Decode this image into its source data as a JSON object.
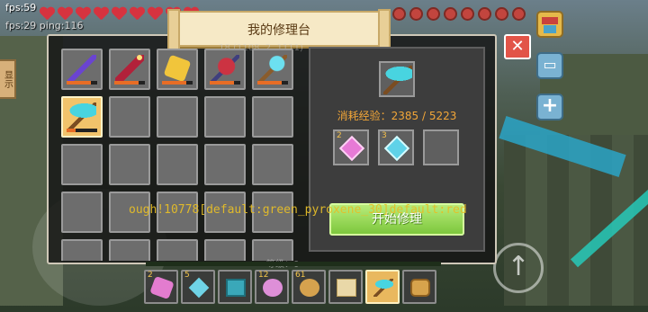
{
  "hud": {
    "fps": "fps:59",
    "ping": "fps:29 ping:116",
    "hearts": 9,
    "food": 8,
    "side_tab": "显示"
  },
  "dialog": {
    "title": "我的修理台",
    "faint_text": "… 18 (1108, 2, 1111)",
    "close_label": "✕",
    "inventory": [
      {
        "icon": "purple-sword-icon",
        "durability": 0.8
      },
      {
        "icon": "red-sword-icon",
        "durability": 0.8
      },
      {
        "icon": "golden-scroll-icon",
        "durability": 0.8
      },
      {
        "icon": "red-axe-icon",
        "durability": 0.8
      },
      {
        "icon": "diamond-shovel-icon",
        "durability": 0.8
      },
      {
        "icon": "diamond-pickaxe-icon",
        "durability": 0.3,
        "selected": true
      }
    ],
    "cost_text": "消耗经验：2385 / 5223",
    "materials": [
      {
        "count": "2",
        "icon": "pink-gem-icon"
      },
      {
        "count": "3",
        "icon": "blue-gem-icon"
      },
      {
        "count": "",
        "icon": ""
      }
    ],
    "start_button": "开始修理",
    "error_overlay": "ough!10778[default:green_pyroxene_30]default:red"
  },
  "hotbar": {
    "label": "等级：0",
    "xp_fill": 0.0,
    "slots": [
      {
        "count": "2",
        "icon": "pink-gem-icon"
      },
      {
        "count": "5",
        "icon": "blue-gem-icon"
      },
      {
        "count": "",
        "icon": "cyan-block-icon"
      },
      {
        "count": "12",
        "icon": "pink-orb-icon"
      },
      {
        "count": "61",
        "icon": "cookie-icon"
      },
      {
        "count": "",
        "icon": "map-icon"
      },
      {
        "count": "",
        "icon": "pickaxe-icon",
        "selected": true
      },
      {
        "count": "",
        "icon": "backpack-icon"
      }
    ]
  }
}
